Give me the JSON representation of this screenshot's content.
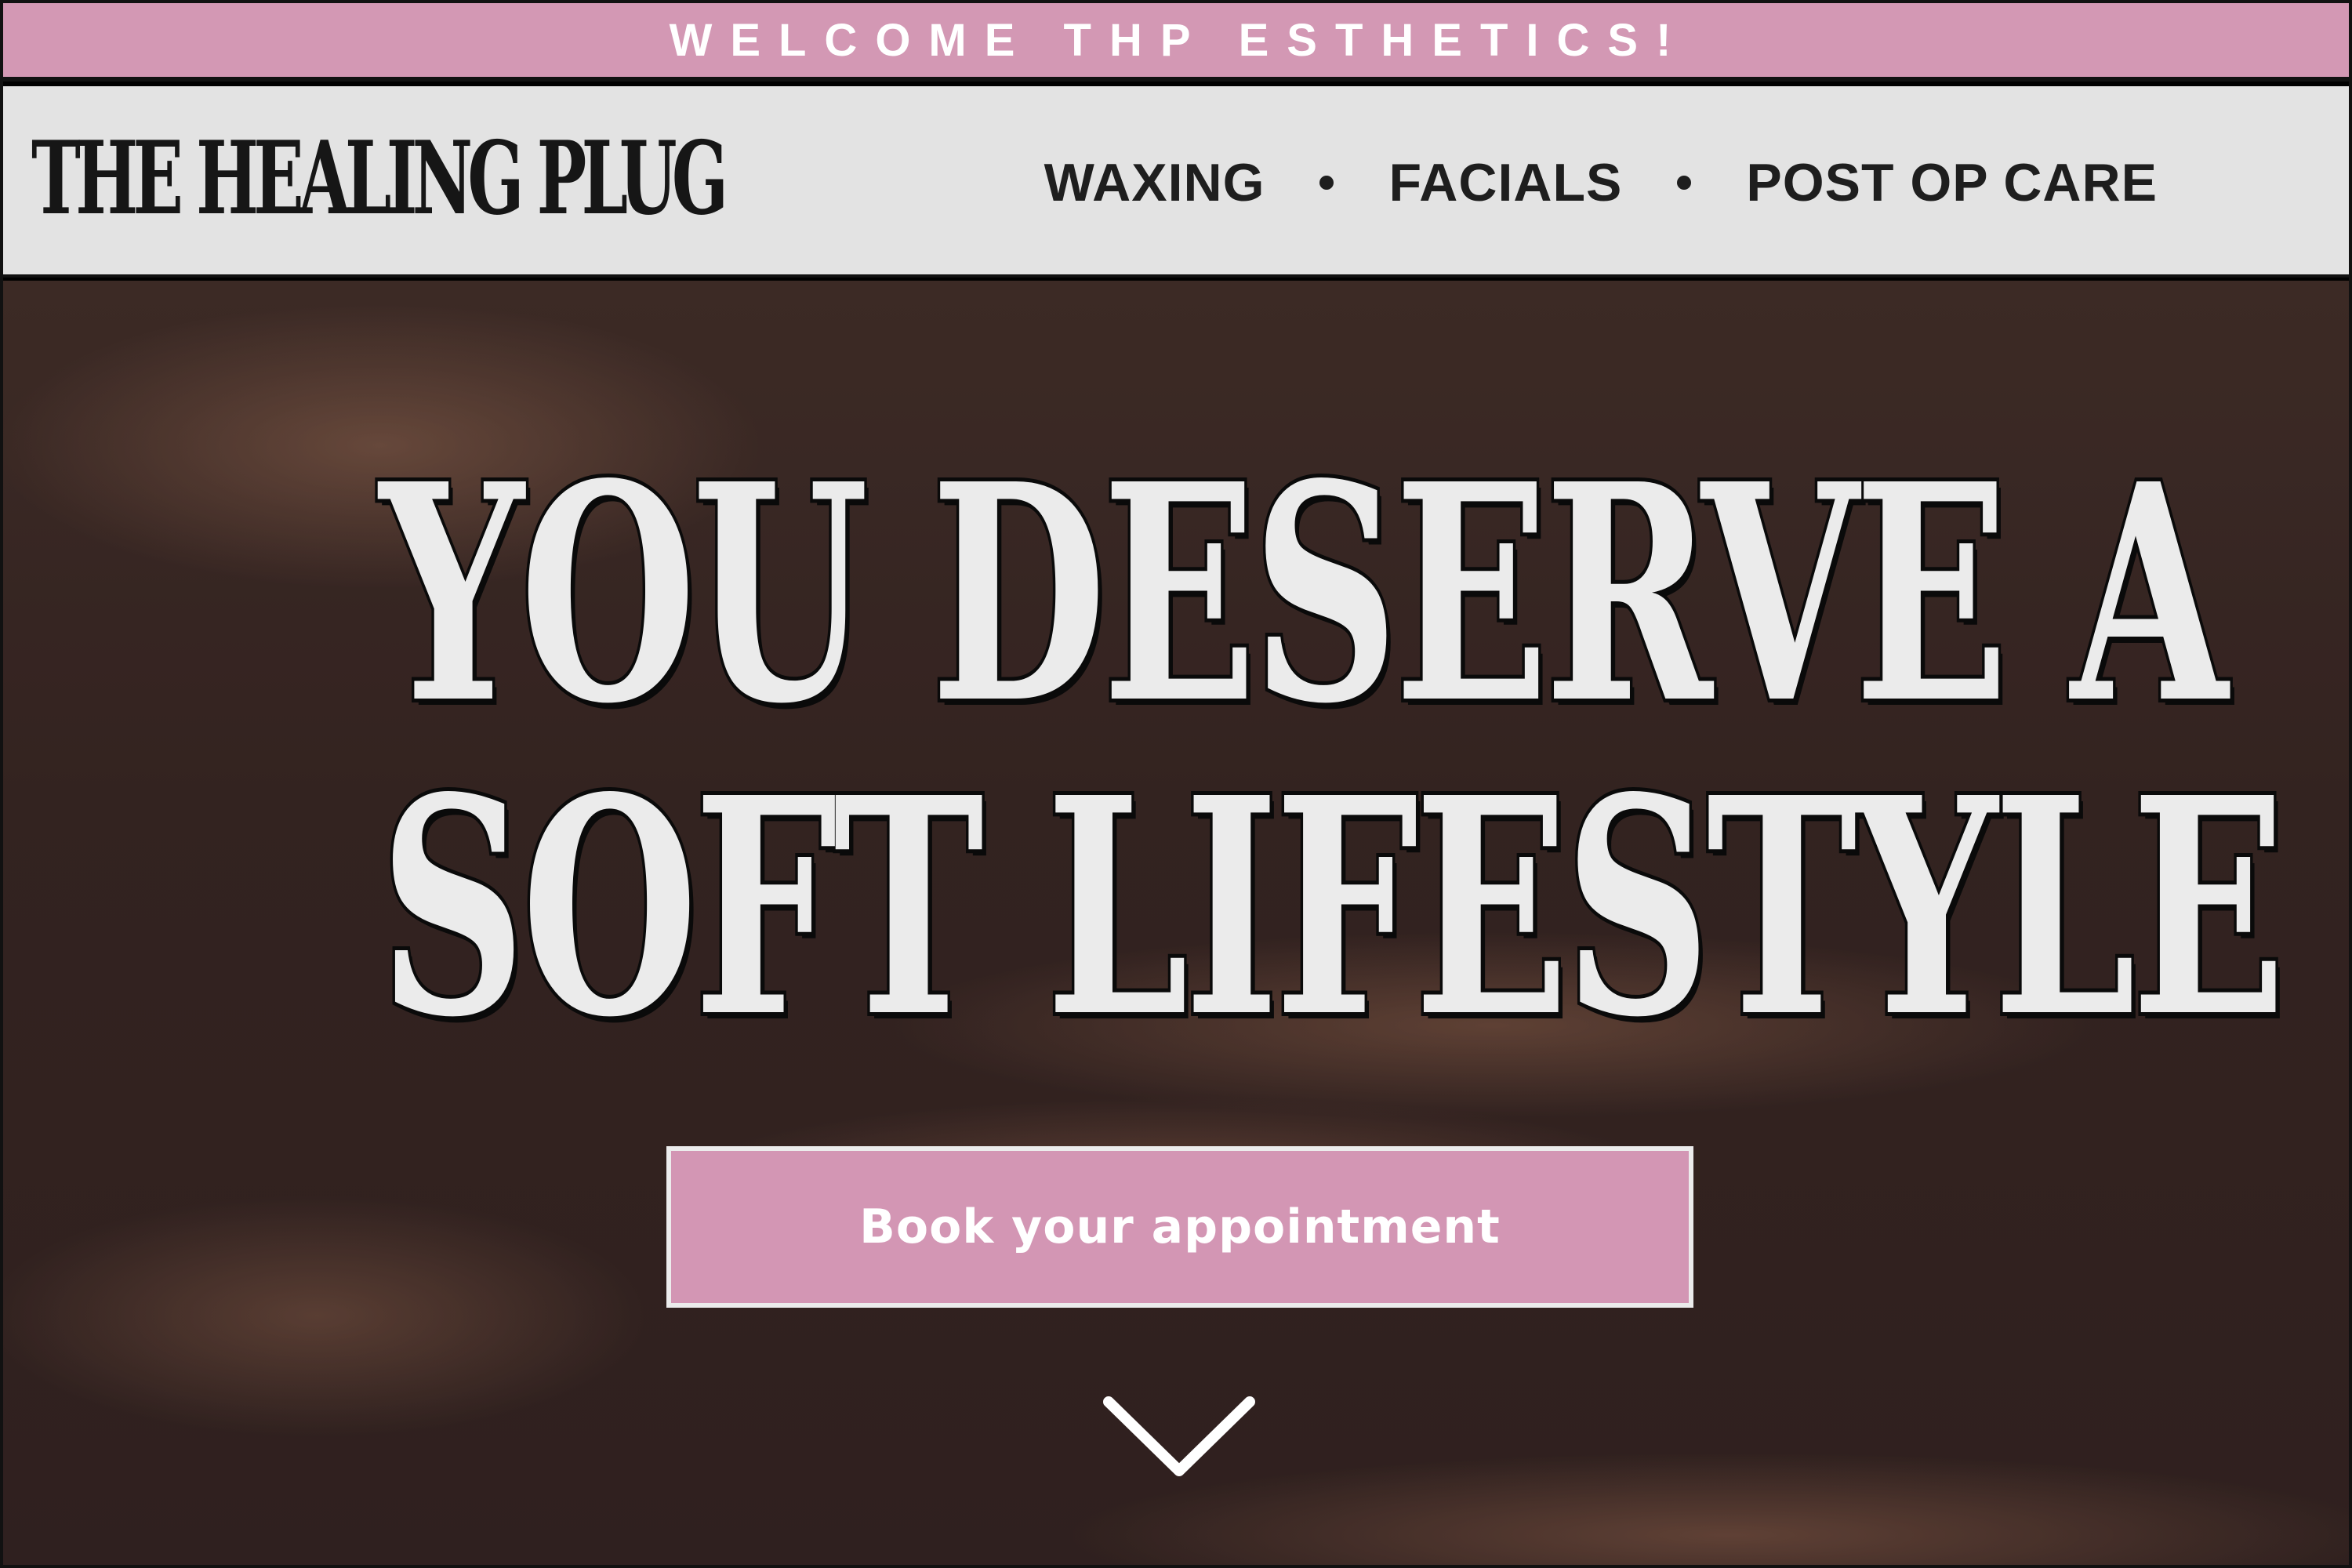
{
  "announcement": {
    "text": "WELCOME THP ESTHETICS!"
  },
  "header": {
    "logo_text": "THE HEALING PLUG",
    "nav": [
      {
        "label": "WAXING"
      },
      {
        "label": "FACIALS"
      },
      {
        "label": "POST OP CARE"
      }
    ]
  },
  "hero": {
    "headline_line1": "YOU DESERVE A",
    "headline_line2": "SOFT LIFESTYLE",
    "cta_label": "Book your appointment",
    "scroll_icon": "chevron-down-icon"
  },
  "colors": {
    "accent_pink": "#d398b4",
    "header_bg": "#e3e3e3",
    "text_dark": "#1e1e1e"
  }
}
